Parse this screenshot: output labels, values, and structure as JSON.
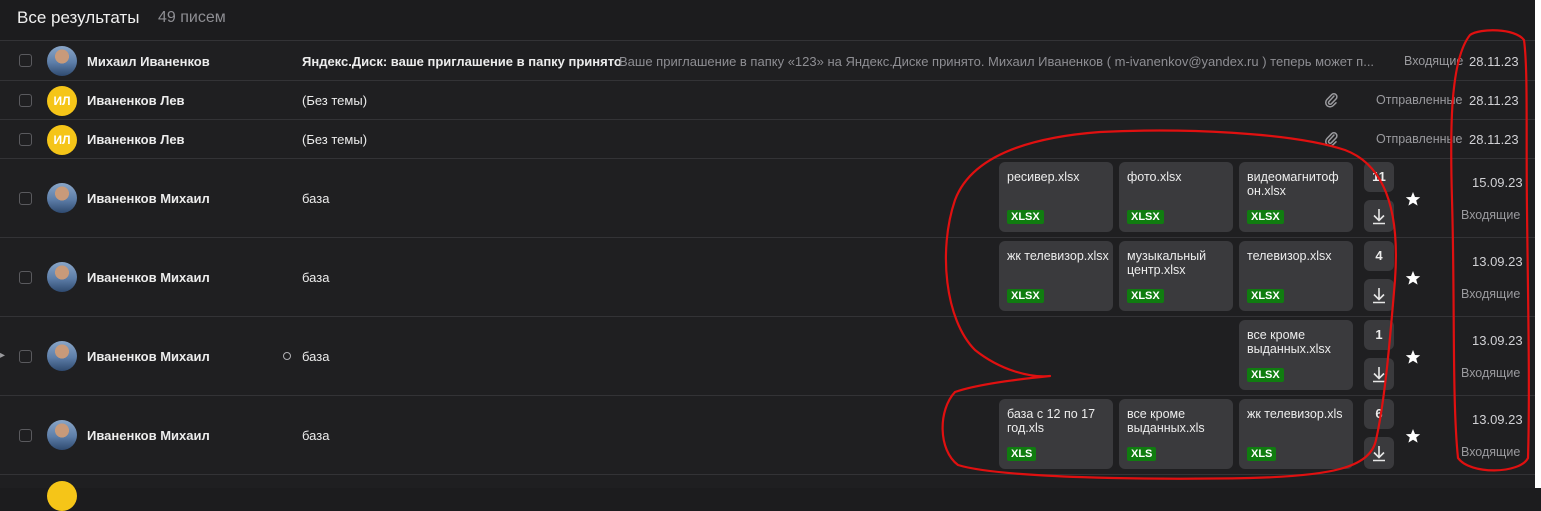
{
  "header": {
    "title": "Все результаты",
    "count": "49 писем"
  },
  "rows": [
    {
      "sender": "Михаил Иваненков",
      "subject": "Яндекс.Диск: ваше приглашение в папку принято",
      "snippet": "Ваше приглашение в папку «123» на Яндекс.Диске принято. Михаил Иваненков ( m-ivanenkov@yandex.ru ) теперь может п...",
      "folder": "Входящие",
      "date": "28.11.23"
    },
    {
      "sender": "Иваненков Лев",
      "initials": "ИЛ",
      "subject": "(Без темы)",
      "folder": "Отправленные",
      "date": "28.11.23"
    },
    {
      "sender": "Иваненков Лев",
      "initials": "ИЛ",
      "subject": "(Без темы)",
      "folder": "Отправленные",
      "date": "28.11.23"
    },
    {
      "sender": "Иваненков Михаил",
      "subject": "база",
      "date": "15.09.23",
      "folder": "Входящие",
      "count": "11",
      "attachments": [
        {
          "name": "ресивер.xlsx",
          "type": "XLSX"
        },
        {
          "name": "фото.xlsx",
          "type": "XLSX"
        },
        {
          "name": "видеомагнитоф он.xlsx",
          "type": "XLSX"
        }
      ]
    },
    {
      "sender": "Иваненков Михаил",
      "subject": "база",
      "date": "13.09.23",
      "folder": "Входящие",
      "count": "4",
      "attachments": [
        {
          "name": "жк телевизор.xlsx",
          "type": "XLSX"
        },
        {
          "name": "музыкальный центр.xlsx",
          "type": "XLSX"
        },
        {
          "name": "телевизор.xlsx",
          "type": "XLSX"
        }
      ]
    },
    {
      "sender": "Иваненков Михаил",
      "subject": "база",
      "date": "13.09.23",
      "folder": "Входящие",
      "count": "1",
      "attachments": [
        {
          "name": "все кроме выданных.xlsx",
          "type": "XLSX"
        }
      ]
    },
    {
      "sender": "Иваненков Михаил",
      "subject": "база",
      "date": "13.09.23",
      "folder": "Входящие",
      "count": "6",
      "attachments": [
        {
          "name": "база с 12 по 17 год.xls",
          "type": "XLS"
        },
        {
          "name": "все кроме выданных.xls",
          "type": "XLS"
        },
        {
          "name": "жк телевизор.xls",
          "type": "XLS"
        }
      ]
    }
  ],
  "icons": {
    "checkbox": "checkbox-icon",
    "attachment": "paperclip-icon",
    "download": "download-icon",
    "star": "star-icon",
    "unread": "unread-dot-icon",
    "flag": "flag-icon"
  },
  "colors": {
    "background": "#1c1c1e",
    "badge": "#107c10",
    "avatar_initials": "#f5c518",
    "annotation": "#e01010"
  }
}
